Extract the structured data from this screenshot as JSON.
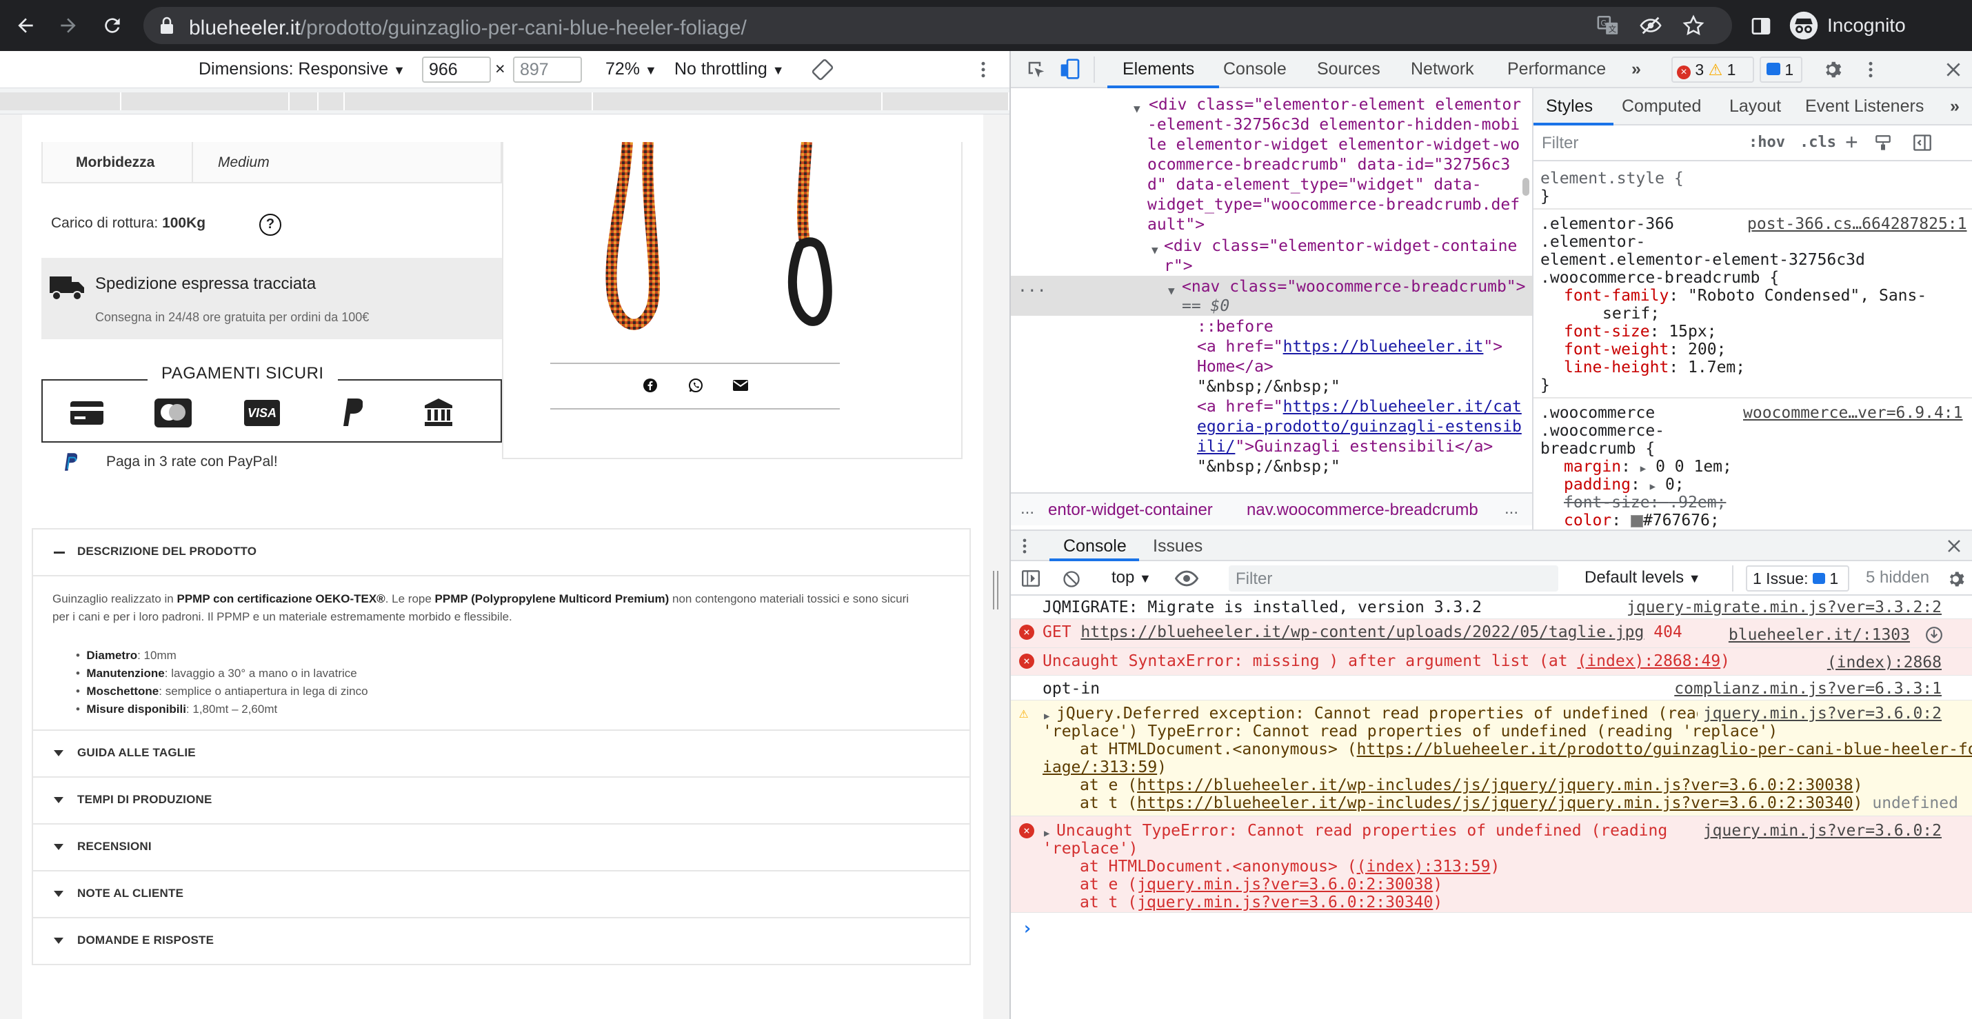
{
  "browser": {
    "url_host": "blueheeler.it",
    "url_path": "/prodotto/guinzaglio-per-cani-blue-heeler-foliage/",
    "incognito_label": "Incognito"
  },
  "device_toolbar": {
    "dimensions_label": "Dimensions: Responsive",
    "width": "966",
    "height": "897",
    "times": "×",
    "zoom": "72%",
    "throttling": "No throttling"
  },
  "product": {
    "softness_label": "Morbidezza",
    "softness_value": "Medium",
    "breaking_label": "Carico di rottura:",
    "breaking_value": "100Kg",
    "shipping_title": "Spedizione espressa tracciata",
    "shipping_sub": "Consegna in 24/48 ore gratuita per ordini da 100€",
    "payments_title": "PAGAMENTI SICURI",
    "paypal_text": "Paga in 3 rate con PayPal!",
    "payment_icons": [
      "credit-card-icon",
      "mastercard-icon",
      "visa-icon",
      "paypal-icon",
      "bank-icon"
    ],
    "share_icons": [
      "facebook-icon",
      "whatsapp-icon",
      "mail-icon"
    ],
    "visa_text": "VISA"
  },
  "description": {
    "header": "DESCRIZIONE DEL PRODOTTO",
    "p_start": "Guinzaglio realizzato in ",
    "p_b1": "PPMP con certificazione OEKO-TEX®",
    "p_mid": ".  Le rope ",
    "p_b2": "PPMP (Polypropylene Multicord Premium)",
    "p_end": " non contengono materiali tossici e sono sicuri",
    "p_line2": "per i cani e per i loro padroni. Il PPMP e un materiale estremamente morbido e flessibile.",
    "bullets": [
      {
        "label": "Diametro",
        "value": ": 10mm"
      },
      {
        "label": "Manutenzione",
        "value": ": lavaggio a 30° a mano o in lavatrice"
      },
      {
        "label": "Moschettone",
        "value": ": semplice o antiapertura in lega di zinco"
      },
      {
        "label": "Misure disponibili",
        "value": ": 1,80mt – 2,60mt"
      }
    ]
  },
  "accordion": [
    "GUIDA ALLE TAGLIE",
    "TEMPI DI PRODUZIONE",
    "RECENSIONI",
    "NOTE AL CLIENTE",
    "DOMANDE E RISPOSTE"
  ],
  "devtools": {
    "tabs": [
      "Elements",
      "Console",
      "Sources",
      "Network",
      "Performance"
    ],
    "errors": "3",
    "warnings": "1",
    "messages": "1",
    "elements": {
      "l1_open": "<div class=\"elementor-element elementor",
      "l2": "-element-32756c3d elementor-hidden-mobi",
      "l3": "le elementor-widget elementor-widget-wo",
      "l4": "ocommerce-breadcrumb\" data-id=\"32756c3",
      "l5": "d\" data-element_type=\"widget\" data-",
      "l6": "widget_type=\"woocommerce-breadcrumb.def",
      "l7": "ault\">",
      "l8": "<div class=\"elementor-widget-containe",
      "l9": "r\">",
      "l10": "<nav class=\"woocommerce-breadcrumb\">",
      "l11": "== $0",
      "l12": "::before",
      "l13_a": "<a href=\"",
      "l13_link": "https://blueheeler.it",
      "l13_b": "\">",
      "l14": "Home</a>",
      "l15": "\"&nbsp;/&nbsp;\"",
      "l16_a": "<a href=\"",
      "l16_link": "https://blueheeler.it/cat",
      "l17_link": "egoria-prodotto/guinzagli-estensib",
      "l18_link": "ili/",
      "l18_b": "\">Guinzagli estensibili</a>",
      "l19": "\"&nbsp;/&nbsp;\""
    },
    "breadcrumb_1": "...",
    "breadcrumb_2": "entor-widget-container",
    "breadcrumb_3": "nav.woocommerce-breadcrumb",
    "styles_tabs": [
      "Styles",
      "Computed",
      "Layout",
      "Event Listeners"
    ],
    "styles_filter": "Filter",
    "hov": ":hov",
    "cls": ".cls",
    "styles": {
      "el_style": "element.style {",
      "close": "}",
      "r1_sel1": ".elementor-366",
      "r1_src": "post-366.cs…664287825:1",
      "r1_sel2": ".elementor-",
      "r1_sel3": "element.elementor-element-32756c3d",
      "r1_sel4": ".woocommerce-breadcrumb {",
      "r1_p1": "font-family",
      "r1_v1": "\"Roboto Condensed\", Sans-",
      "r1_v1b": "serif;",
      "r1_p2": "font-size",
      "r1_v2": "15px;",
      "r1_p3": "font-weight",
      "r1_v3": "200;",
      "r1_p4": "line-height",
      "r1_v4": "1.7em;",
      "r2_sel1": ".woocommerce",
      "r2_src": "woocommerce…ver=6.9.4:1",
      "r2_sel2": ".woocommerce-",
      "r2_sel3": "breadcrumb {",
      "r2_p1": "margin",
      "r2_v1": "0 0 1em;",
      "r2_p2": "padding",
      "r2_v2": "0;",
      "r2_p3": "font-size",
      "r2_v3": ".92em;",
      "r2_p4": "color",
      "r2_v4": "#767676;"
    },
    "console_tabs": [
      "Console",
      "Issues"
    ],
    "context": "top",
    "filter": "Filter",
    "levels": "Default levels",
    "issues": "1 Issue:",
    "issues_count": "1",
    "hidden": "5 hidden",
    "logs": [
      {
        "text": "JQMIGRATE: Migrate is installed, version 3.3.2",
        "src": "jquery-migrate.min.js?ver=3.3.2:2"
      },
      {
        "pre": "GET ",
        "link": "https://blueheeler.it/wp-content/uploads/2022/05/taglie.jpg",
        "post": " 404",
        "src": "blueheeler.it/:1303"
      },
      {
        "pre": "Uncaught SyntaxError: missing ) after argument list (at ",
        "link": "(index):2868:49",
        "post": ")",
        "src": "(index):2868"
      },
      {
        "text": "opt-in",
        "src": "complianz.min.js?ver=6.3.3:1"
      },
      {
        "l1": "jQuery.Deferred exception: Cannot read properties of undefined (reading",
        "l2": "'replace') TypeError: Cannot read properties of undefined (reading 'replace')",
        "l3a": "at HTMLDocument.<anonymous> (",
        "l3link": "https://blueheeler.it/prodotto/guinzaglio-per-cani-blue-heeler-fol",
        "l4link": "iage/:313:59",
        "l4b": ")",
        "l5a": "at e (",
        "l5link": "https://blueheeler.it/wp-includes/js/jquery/jquery.min.js?ver=3.6.0:2:30038",
        "l5b": ")",
        "l6a": "at t (",
        "l6link": "https://blueheeler.it/wp-includes/js/jquery/jquery.min.js?ver=3.6.0:2:30340",
        "l6b": ") ",
        "l6c": "undefined",
        "src": "jquery.min.js?ver=3.6.0:2"
      },
      {
        "l1": "Uncaught TypeError: Cannot read properties of undefined (reading",
        "l2": "'replace')",
        "l3a": "at HTMLDocument.<anonymous> (",
        "l3link": "(index):313:59",
        "l3b": ")",
        "l4a": "at e (",
        "l4link": "jquery.min.js?ver=3.6.0:2:30038",
        "l4b": ")",
        "l5a": "at t (",
        "l5link": "jquery.min.js?ver=3.6.0:2:30340",
        "l5b": ")",
        "src": "jquery.min.js?ver=3.6.0:2"
      }
    ],
    "prompt": "›"
  }
}
